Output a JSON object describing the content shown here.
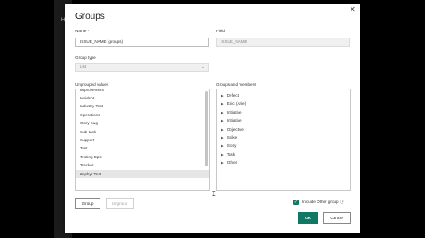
{
  "background": {
    "hint": "Ho"
  },
  "dialog": {
    "title": "Groups",
    "close": "✕",
    "name_label": "Name *",
    "name_value": "ISSUE_NAME (groups)",
    "field_label": "Field",
    "field_value": "ISSUE_NAME",
    "group_type_label": "Group type",
    "group_type_value": "List",
    "ungrouped_label": "Ungrouped values",
    "groups_label": "Groups and members",
    "ungrouped_partial": "Improvement",
    "ungrouped_items": [
      "Incident",
      "Industry Test",
      "Operations",
      "Story-bug",
      "Sub-task",
      "Support",
      "Test",
      "Testing Epic",
      "Tracker",
      "Zephyr Test"
    ],
    "ungrouped_selected": "Zephyr Test",
    "groups": [
      "Defect",
      "Epic (Arie)",
      "Initiative",
      "Initiative",
      "Objective",
      "Spike",
      "Story",
      "Task",
      "Other"
    ],
    "group_button": "Group",
    "ungroup_button": "Ungroup",
    "include_other_label": "Include Other group",
    "info_icon": "ⓘ",
    "ok_button": "OK",
    "cancel_button": "Cancel"
  },
  "colors": {
    "accent": "#117865"
  }
}
